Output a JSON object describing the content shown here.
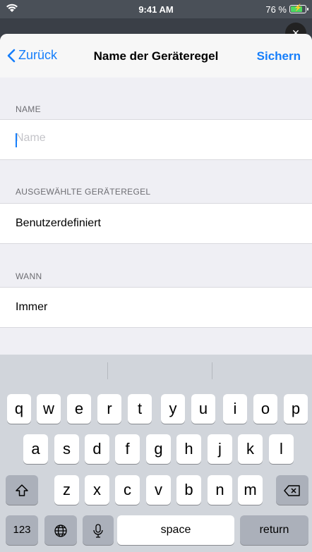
{
  "status_bar": {
    "time": "9:41 AM",
    "battery_text": "76 %"
  },
  "nav": {
    "back_label": "Zurück",
    "title": "Name der Geräteregel",
    "save_label": "Sichern"
  },
  "sections": {
    "name": {
      "header": "NAME",
      "placeholder": "Name",
      "value": ""
    },
    "selected_rule": {
      "header": "AUSGEWÄHLTE GERÄTEREGEL",
      "value": "Benutzerdefiniert"
    },
    "when": {
      "header": "WANN",
      "value": "Immer"
    }
  },
  "keyboard": {
    "row1": [
      "q",
      "w",
      "e",
      "r",
      "t",
      "y",
      "u",
      "i",
      "o",
      "p"
    ],
    "row2": [
      "a",
      "s",
      "d",
      "f",
      "g",
      "h",
      "j",
      "k",
      "l"
    ],
    "row3": [
      "z",
      "x",
      "c",
      "v",
      "b",
      "n",
      "m"
    ],
    "numbers_label": "123",
    "space_label": "space",
    "return_label": "return"
  },
  "colors": {
    "accent": "#157efb",
    "background": "#efeff4",
    "keyboard": "#d1d5db"
  }
}
